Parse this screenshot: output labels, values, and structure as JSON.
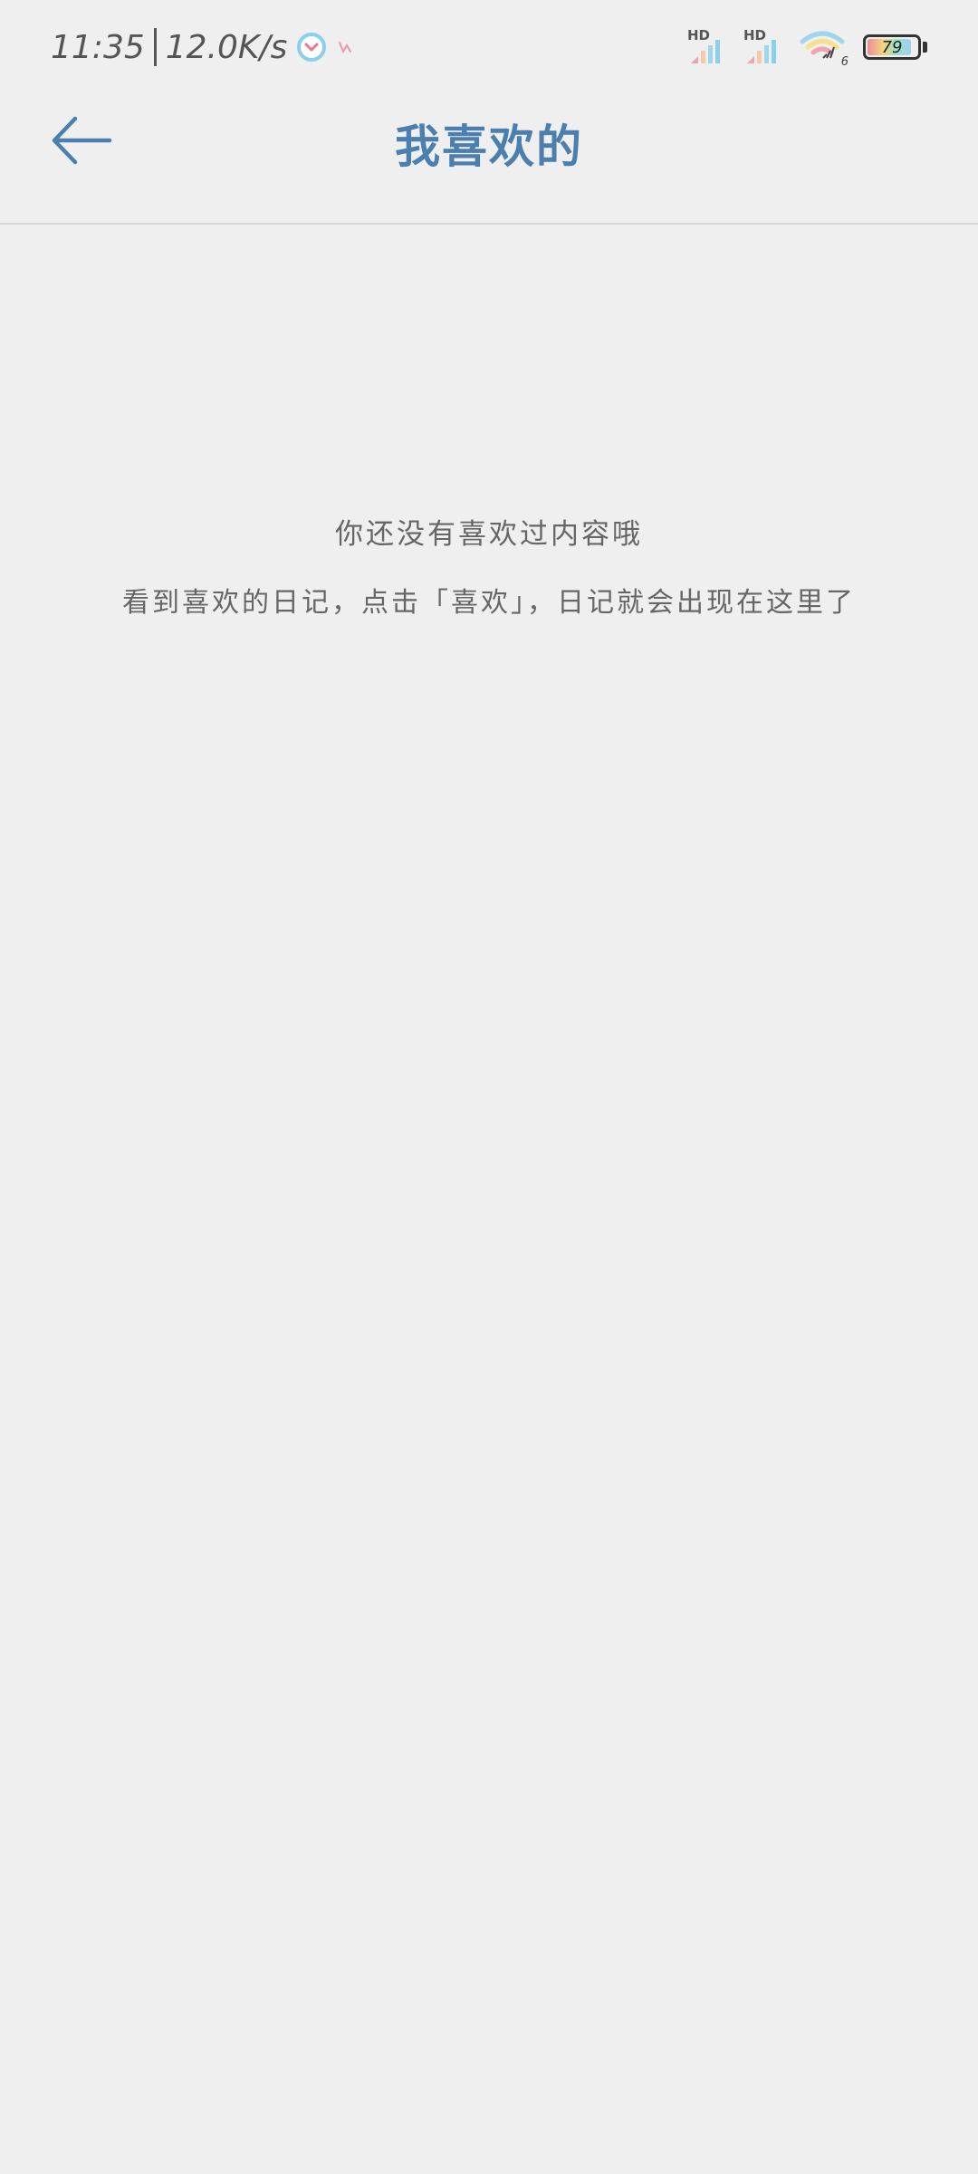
{
  "status_bar": {
    "time": "11:35",
    "net_speed": "12.0K/s",
    "signal_1_label": "HD",
    "signal_2_label": "HD",
    "wifi_badge": "6",
    "battery_level": "79",
    "icons": [
      "alarm-icon",
      "notification-icon",
      "signal-icon",
      "signal-icon",
      "wifi-icon",
      "battery-icon"
    ]
  },
  "header": {
    "back_icon": "arrow-left-icon",
    "title": "我喜欢的"
  },
  "empty_state": {
    "title": "你还没有喜欢过内容哦",
    "hint": "看到喜欢的日记，点击「喜欢」，日记就会出现在这里了"
  },
  "colors": {
    "accent": "#4a7fae",
    "background": "#efeff0",
    "text_muted": "#666666",
    "divider": "#d8d8da"
  }
}
